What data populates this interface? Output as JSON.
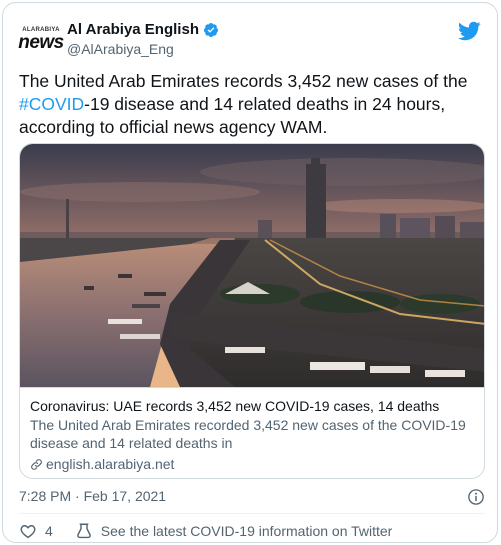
{
  "header": {
    "avatar_small": "ALARABIYA",
    "avatar_big": "news",
    "display_name": "Al Arabiya English",
    "handle": "@AlArabiya_Eng"
  },
  "tweet": {
    "text_before": "The United Arab Emirates records 3,452 new cases of the ",
    "hashtag": "#COVID",
    "text_after": "-19 disease and 14 related deaths in 24 hours, according to official news agency WAM."
  },
  "link_card": {
    "title": "Coronavirus: UAE records 3,452 new COVID-19 cases, 14 deaths",
    "description": "The United Arab Emirates recorded 3,452 new cases of the COVID-19 disease and 14 related deaths in",
    "domain": "english.alarabiya.net"
  },
  "meta": {
    "timestamp": "7:28 PM · Feb 17, 2021"
  },
  "actions": {
    "like_count": "4",
    "covid_info": "See the latest COVID-19 information on Twitter"
  },
  "colors": {
    "accent": "#1d9bf0",
    "secondary_text": "#536471",
    "border": "#cfd9de"
  }
}
